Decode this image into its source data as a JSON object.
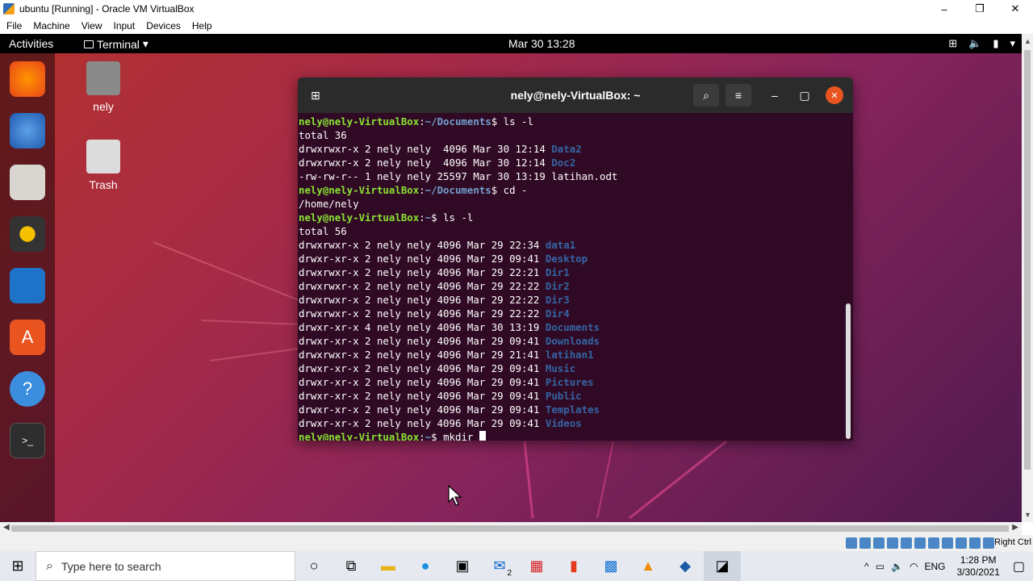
{
  "window": {
    "title": "ubuntu [Running] - Oracle VM VirtualBox",
    "minimize": "–",
    "maximize": "❐",
    "close": "✕"
  },
  "menu": [
    "File",
    "Machine",
    "View",
    "Input",
    "Devices",
    "Help"
  ],
  "topbar": {
    "activities": "Activities",
    "app_menu": "Terminal",
    "app_menu_arrow": "▾",
    "clock": "Mar 30  13:28",
    "tray_icons": [
      "network-icon",
      "volume-icon",
      "battery-icon",
      "chevron-down-icon"
    ]
  },
  "dock": [
    "firefox-icon",
    "thunderbird-icon",
    "files-icon",
    "rhythmbox-icon",
    "writer-icon",
    "software-icon",
    "help-icon",
    "terminal-icon"
  ],
  "desktop": [
    {
      "label": "nely",
      "icon": "home-folder-icon"
    },
    {
      "label": "Trash",
      "icon": "trash-icon"
    }
  ],
  "terminal": {
    "title": "nely@nely-VirtualBox: ~",
    "lines": [
      {
        "prompt": "nely@nely-VirtualBox",
        "path": "~/Documents",
        "cmd": "ls -l"
      },
      {
        "text": "total 36"
      },
      {
        "text": "drwxrwxr-x 2 nely nely  4096 Mar 30 12:14 ",
        "dir": "Data2"
      },
      {
        "text": "drwxrwxr-x 2 nely nely  4096 Mar 30 12:14 ",
        "dir": "Doc2"
      },
      {
        "text": "-rw-rw-r-- 1 nely nely 25597 Mar 30 13:19 latihan.odt"
      },
      {
        "prompt": "nely@nely-VirtualBox",
        "path": "~/Documents",
        "cmd": "cd -"
      },
      {
        "text": "/home/nely"
      },
      {
        "prompt": "nely@nely-VirtualBox",
        "path": "~",
        "cmd": "ls -l"
      },
      {
        "text": "total 56"
      },
      {
        "text": "drwxrwxr-x 2 nely nely 4096 Mar 29 22:34 ",
        "dir": "data1"
      },
      {
        "text": "drwxr-xr-x 2 nely nely 4096 Mar 29 09:41 ",
        "dir": "Desktop"
      },
      {
        "text": "drwxrwxr-x 2 nely nely 4096 Mar 29 22:21 ",
        "dir": "Dir1"
      },
      {
        "text": "drwxrwxr-x 2 nely nely 4096 Mar 29 22:22 ",
        "dir": "Dir2"
      },
      {
        "text": "drwxrwxr-x 2 nely nely 4096 Mar 29 22:22 ",
        "dir": "Dir3"
      },
      {
        "text": "drwxrwxr-x 2 nely nely 4096 Mar 29 22:22 ",
        "dir": "Dir4"
      },
      {
        "text": "drwxr-xr-x 4 nely nely 4096 Mar 30 13:19 ",
        "dir": "Documents"
      },
      {
        "text": "drwxr-xr-x 2 nely nely 4096 Mar 29 09:41 ",
        "dir": "Downloads"
      },
      {
        "text": "drwxrwxr-x 2 nely nely 4096 Mar 29 21:41 ",
        "dir": "latihan1"
      },
      {
        "text": "drwxr-xr-x 2 nely nely 4096 Mar 29 09:41 ",
        "dir": "Music"
      },
      {
        "text": "drwxr-xr-x 2 nely nely 4096 Mar 29 09:41 ",
        "dir": "Pictures"
      },
      {
        "text": "drwxr-xr-x 2 nely nely 4096 Mar 29 09:41 ",
        "dir": "Public"
      },
      {
        "text": "drwxr-xr-x 2 nely nely 4096 Mar 29 09:41 ",
        "dir": "Templates"
      },
      {
        "text": "drwxr-xr-x 2 nely nely 4096 Mar 29 09:41 ",
        "dir": "Videos"
      },
      {
        "prompt": "nely@nely-VirtualBox",
        "path": "~",
        "cmd": "mkdir ",
        "cursor": true
      }
    ]
  },
  "statusbar": {
    "host_key": "Right Ctrl"
  },
  "taskbar": {
    "search_placeholder": "Type here to search",
    "apps": [
      "cortana-icon",
      "task-view-icon",
      "file-explorer-icon",
      "edge-icon",
      "store-icon",
      "mail-icon",
      "gift-icon",
      "office-icon",
      "whiteboard-icon",
      "vlc-icon",
      "virtualbox-icon",
      "vm-window-icon"
    ],
    "mail_badge": "2",
    "lang": "ENG",
    "time": "1:28 PM",
    "date": "3/30/2021"
  },
  "colors": {
    "ubuntu_orange": "#e95420",
    "terminal_bg": "#300a24",
    "prompt_green": "#8ae234",
    "dir_blue": "#3465a4"
  }
}
